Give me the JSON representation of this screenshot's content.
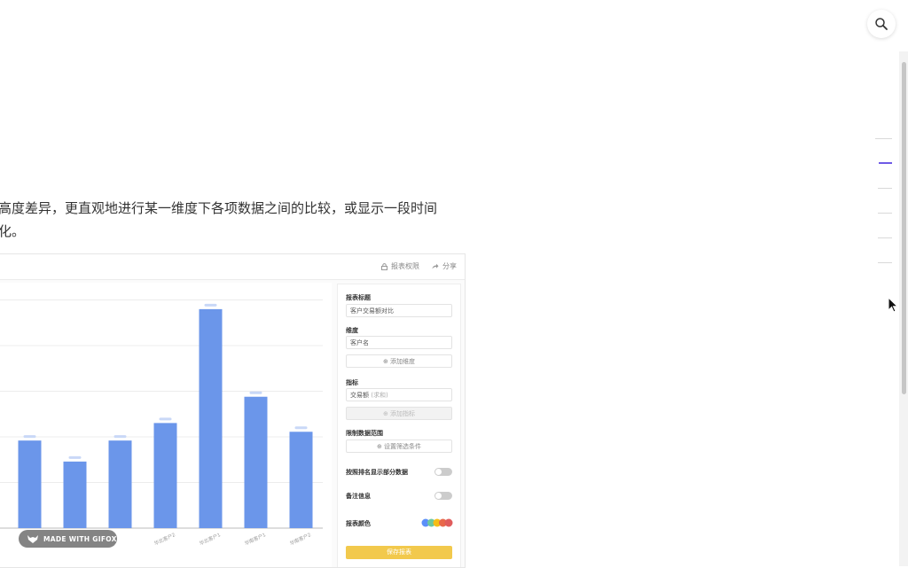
{
  "intro": {
    "line1": "高度差异，更直观地进行某一维度下各项数据之间的比较，或显示一段时间",
    "line2": "化。"
  },
  "toolbar": {
    "permission_label": "报表权限",
    "share_label": "分享"
  },
  "settings": {
    "title_label": "报表标题",
    "title_value": "客户交易额对比",
    "dimension_label": "维度",
    "dimension_value": "客户名",
    "add_dimension": "添加维度",
    "metric_label": "指标",
    "metric_value": "交易额",
    "metric_suffix": "(求和)",
    "add_metric": "添加指标",
    "range_label": "限制数据范围",
    "filter_button": "设置筛选条件",
    "rank_label": "按照排名显示部分数据",
    "note_label": "备注信息",
    "color_label": "报表颜色",
    "save_button": "保存报表",
    "swatch_colors": [
      "#5b8ff9",
      "#6dc8a0",
      "#f6bd16",
      "#e8684a",
      "#e05c5c"
    ]
  },
  "badge": {
    "label": "MADE WITH GIFOX"
  },
  "chart_data": {
    "type": "bar",
    "categories": [
      "",
      "",
      "",
      "华北客户2",
      "华北客户1",
      "华南客户1",
      "华南客户2"
    ],
    "values": [
      50,
      38,
      50,
      60,
      125,
      75,
      55
    ],
    "ylim": [
      0,
      130
    ],
    "grid": true,
    "color": "#6b96ea"
  },
  "colors": {
    "accent": "#6e5ae6",
    "bar": "#6b96ea",
    "save": "#f2c94c"
  }
}
